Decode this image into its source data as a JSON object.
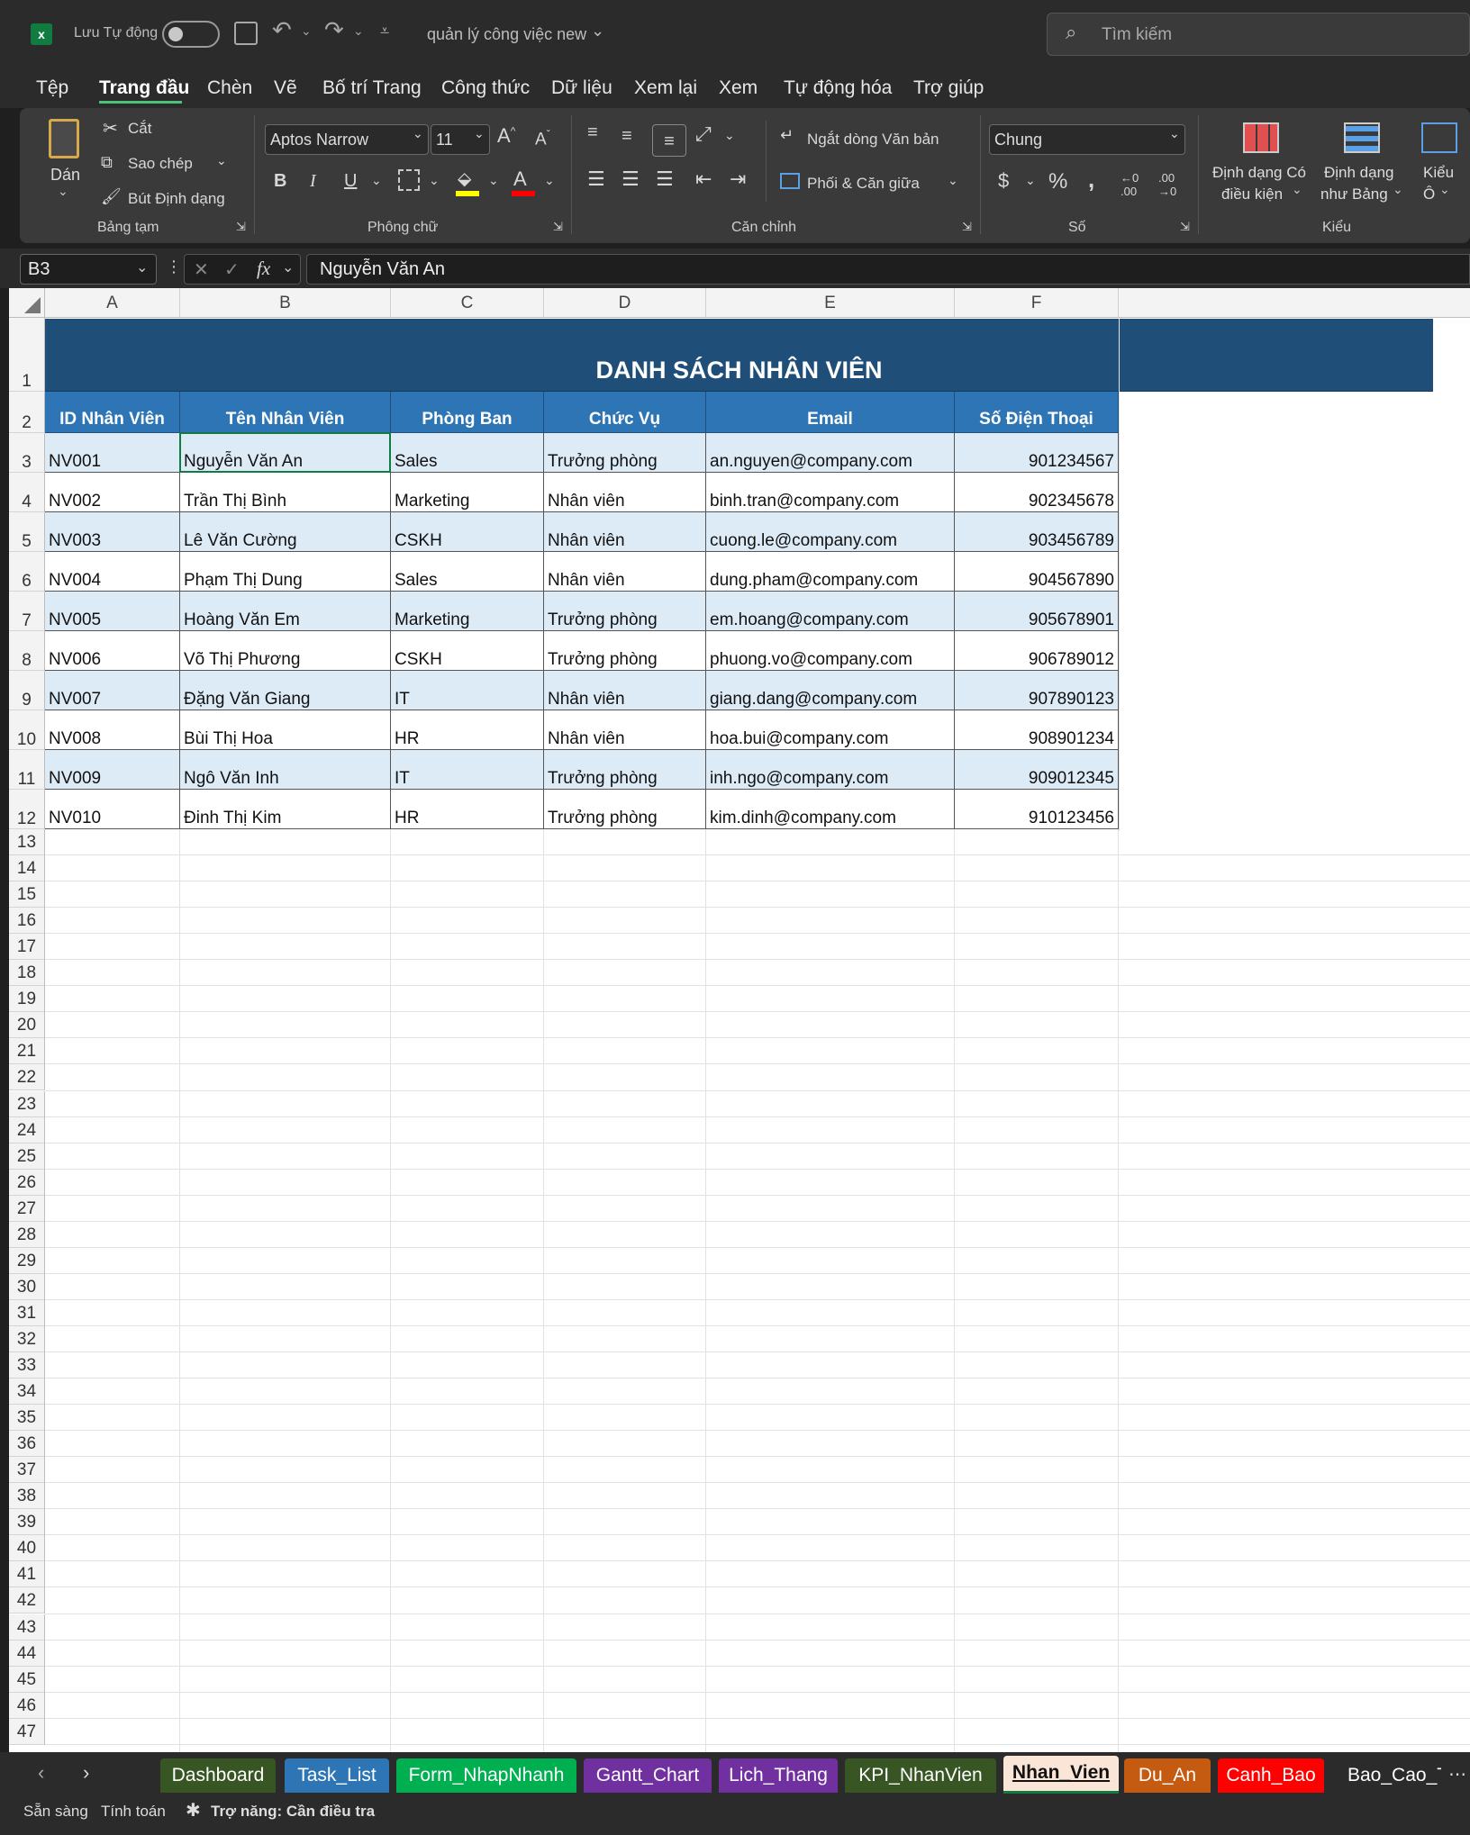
{
  "titlebar": {
    "autosave_label": "Lưu Tự động",
    "doc_title": "quản lý công việc new",
    "search_placeholder": "Tìm kiếm"
  },
  "menu": [
    "Tệp",
    "Trang đầu",
    "Chèn",
    "Vẽ",
    "Bố trí Trang",
    "Công thức",
    "Dữ liệu",
    "Xem lại",
    "Xem",
    "Tự động hóa",
    "Trợ giúp"
  ],
  "ribbon": {
    "paste": "Dán",
    "cut": "Cắt",
    "copy": "Sao chép",
    "format_painter": "Bút Định dạng",
    "clipboard_group": "Bảng tạm",
    "font_name": "Aptos Narrow",
    "font_size": "11",
    "font_group": "Phông chữ",
    "wrap_text": "Ngắt dòng Văn bản",
    "merge_center": "Phối & Căn giữa",
    "align_group": "Căn chỉnh",
    "number_format": "Chung",
    "number_group": "Số",
    "cond_format_1": "Định dạng Có",
    "cond_format_2": "điều kiện",
    "format_table_1": "Định dạng",
    "format_table_2": "như Bảng",
    "cell_styles_1": "Kiểu",
    "cell_styles_2": "Ô",
    "styles_group": "Kiểu"
  },
  "formula_bar": {
    "name_box": "B3",
    "fx": "fx",
    "content": "Nguyễn Văn An"
  },
  "columns": [
    "A",
    "B",
    "C",
    "D",
    "E",
    "F"
  ],
  "sheet_title": "DANH SÁCH NHÂN VIÊN",
  "table_headers": [
    "ID Nhân Viên",
    "Tên Nhân Viên",
    "Phòng Ban",
    "Chức Vụ",
    "Email",
    "Số Điện Thoại"
  ],
  "rows": [
    [
      "NV001",
      "Nguyễn Văn An",
      "Sales",
      "Trưởng phòng",
      "an.nguyen@company.com",
      "901234567"
    ],
    [
      "NV002",
      "Trần Thị Bình",
      "Marketing",
      "Nhân viên",
      "binh.tran@company.com",
      "902345678"
    ],
    [
      "NV003",
      "Lê Văn Cường",
      "CSKH",
      "Nhân viên",
      "cuong.le@company.com",
      "903456789"
    ],
    [
      "NV004",
      "Phạm Thị Dung",
      "Sales",
      "Nhân viên",
      "dung.pham@company.com",
      "904567890"
    ],
    [
      "NV005",
      "Hoàng Văn Em",
      "Marketing",
      "Trưởng phòng",
      "em.hoang@company.com",
      "905678901"
    ],
    [
      "NV006",
      "Võ Thị Phương",
      "CSKH",
      "Trưởng phòng",
      "phuong.vo@company.com",
      "906789012"
    ],
    [
      "NV007",
      "Đặng Văn Giang",
      "IT",
      "Nhân viên",
      "giang.dang@company.com",
      "907890123"
    ],
    [
      "NV008",
      "Bùi Thị Hoa",
      "HR",
      "Nhân viên",
      "hoa.bui@company.com",
      "908901234"
    ],
    [
      "NV009",
      "Ngô Văn Inh",
      "IT",
      "Trưởng phòng",
      "inh.ngo@company.com",
      "909012345"
    ],
    [
      "NV010",
      "Đinh Thị Kim",
      "HR",
      "Trưởng phòng",
      "kim.dinh@company.com",
      "910123456"
    ]
  ],
  "row_numbers": [
    "1",
    "2",
    "3",
    "4",
    "5",
    "6",
    "7",
    "8",
    "9",
    "10",
    "11",
    "12",
    "13",
    "14",
    "15",
    "16",
    "17",
    "18",
    "19",
    "20",
    "21",
    "22",
    "23",
    "24",
    "25",
    "26",
    "27",
    "28",
    "29",
    "30",
    "31",
    "32",
    "33",
    "34",
    "35",
    "36",
    "37",
    "38",
    "39",
    "40",
    "41",
    "42",
    "43",
    "44",
    "45",
    "46",
    "47"
  ],
  "sheet_tabs": [
    {
      "name": "Dashboard",
      "color": "#375623"
    },
    {
      "name": "Task_List",
      "color": "#2e75b6"
    },
    {
      "name": "Form_NhapNhanh",
      "color": "#00b050"
    },
    {
      "name": "Gantt_Chart",
      "color": "#7030a0"
    },
    {
      "name": "Lich_Thang",
      "color": "#7030a0"
    },
    {
      "name": "KPI_NhanVien",
      "color": "#375623"
    },
    {
      "name": "Nhan_Vien",
      "color": "#fbe5d6"
    },
    {
      "name": "Du_An",
      "color": "#c55a11"
    },
    {
      "name": "Canh_Bao",
      "color": "#ff0000"
    },
    {
      "name": "Bao_Cao_T",
      "color": "#2b2b2b"
    }
  ],
  "status": {
    "ready": "Sẵn sàng",
    "calc": "Tính toán",
    "accessibility": "Trợ năng: Cần điều tra"
  }
}
